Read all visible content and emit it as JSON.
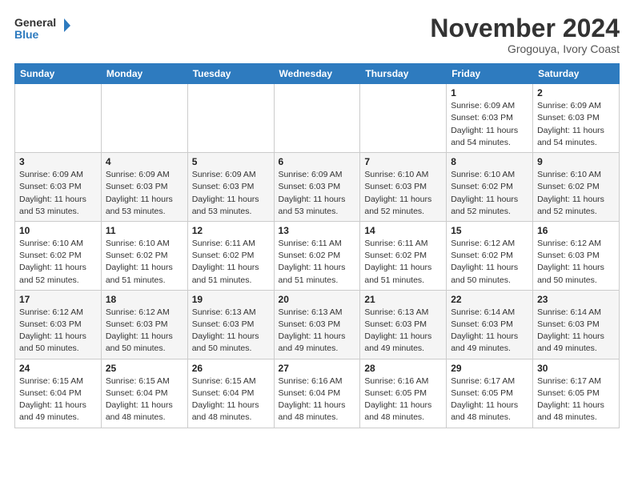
{
  "logo": {
    "line1": "General",
    "line2": "Blue"
  },
  "title": "November 2024",
  "location": "Grogouya, Ivory Coast",
  "days_header": [
    "Sunday",
    "Monday",
    "Tuesday",
    "Wednesday",
    "Thursday",
    "Friday",
    "Saturday"
  ],
  "weeks": [
    [
      {
        "day": "",
        "info": ""
      },
      {
        "day": "",
        "info": ""
      },
      {
        "day": "",
        "info": ""
      },
      {
        "day": "",
        "info": ""
      },
      {
        "day": "",
        "info": ""
      },
      {
        "day": "1",
        "info": "Sunrise: 6:09 AM\nSunset: 6:03 PM\nDaylight: 11 hours and 54 minutes."
      },
      {
        "day": "2",
        "info": "Sunrise: 6:09 AM\nSunset: 6:03 PM\nDaylight: 11 hours and 54 minutes."
      }
    ],
    [
      {
        "day": "3",
        "info": "Sunrise: 6:09 AM\nSunset: 6:03 PM\nDaylight: 11 hours and 53 minutes."
      },
      {
        "day": "4",
        "info": "Sunrise: 6:09 AM\nSunset: 6:03 PM\nDaylight: 11 hours and 53 minutes."
      },
      {
        "day": "5",
        "info": "Sunrise: 6:09 AM\nSunset: 6:03 PM\nDaylight: 11 hours and 53 minutes."
      },
      {
        "day": "6",
        "info": "Sunrise: 6:09 AM\nSunset: 6:03 PM\nDaylight: 11 hours and 53 minutes."
      },
      {
        "day": "7",
        "info": "Sunrise: 6:10 AM\nSunset: 6:03 PM\nDaylight: 11 hours and 52 minutes."
      },
      {
        "day": "8",
        "info": "Sunrise: 6:10 AM\nSunset: 6:02 PM\nDaylight: 11 hours and 52 minutes."
      },
      {
        "day": "9",
        "info": "Sunrise: 6:10 AM\nSunset: 6:02 PM\nDaylight: 11 hours and 52 minutes."
      }
    ],
    [
      {
        "day": "10",
        "info": "Sunrise: 6:10 AM\nSunset: 6:02 PM\nDaylight: 11 hours and 52 minutes."
      },
      {
        "day": "11",
        "info": "Sunrise: 6:10 AM\nSunset: 6:02 PM\nDaylight: 11 hours and 51 minutes."
      },
      {
        "day": "12",
        "info": "Sunrise: 6:11 AM\nSunset: 6:02 PM\nDaylight: 11 hours and 51 minutes."
      },
      {
        "day": "13",
        "info": "Sunrise: 6:11 AM\nSunset: 6:02 PM\nDaylight: 11 hours and 51 minutes."
      },
      {
        "day": "14",
        "info": "Sunrise: 6:11 AM\nSunset: 6:02 PM\nDaylight: 11 hours and 51 minutes."
      },
      {
        "day": "15",
        "info": "Sunrise: 6:12 AM\nSunset: 6:02 PM\nDaylight: 11 hours and 50 minutes."
      },
      {
        "day": "16",
        "info": "Sunrise: 6:12 AM\nSunset: 6:03 PM\nDaylight: 11 hours and 50 minutes."
      }
    ],
    [
      {
        "day": "17",
        "info": "Sunrise: 6:12 AM\nSunset: 6:03 PM\nDaylight: 11 hours and 50 minutes."
      },
      {
        "day": "18",
        "info": "Sunrise: 6:12 AM\nSunset: 6:03 PM\nDaylight: 11 hours and 50 minutes."
      },
      {
        "day": "19",
        "info": "Sunrise: 6:13 AM\nSunset: 6:03 PM\nDaylight: 11 hours and 50 minutes."
      },
      {
        "day": "20",
        "info": "Sunrise: 6:13 AM\nSunset: 6:03 PM\nDaylight: 11 hours and 49 minutes."
      },
      {
        "day": "21",
        "info": "Sunrise: 6:13 AM\nSunset: 6:03 PM\nDaylight: 11 hours and 49 minutes."
      },
      {
        "day": "22",
        "info": "Sunrise: 6:14 AM\nSunset: 6:03 PM\nDaylight: 11 hours and 49 minutes."
      },
      {
        "day": "23",
        "info": "Sunrise: 6:14 AM\nSunset: 6:03 PM\nDaylight: 11 hours and 49 minutes."
      }
    ],
    [
      {
        "day": "24",
        "info": "Sunrise: 6:15 AM\nSunset: 6:04 PM\nDaylight: 11 hours and 49 minutes."
      },
      {
        "day": "25",
        "info": "Sunrise: 6:15 AM\nSunset: 6:04 PM\nDaylight: 11 hours and 48 minutes."
      },
      {
        "day": "26",
        "info": "Sunrise: 6:15 AM\nSunset: 6:04 PM\nDaylight: 11 hours and 48 minutes."
      },
      {
        "day": "27",
        "info": "Sunrise: 6:16 AM\nSunset: 6:04 PM\nDaylight: 11 hours and 48 minutes."
      },
      {
        "day": "28",
        "info": "Sunrise: 6:16 AM\nSunset: 6:05 PM\nDaylight: 11 hours and 48 minutes."
      },
      {
        "day": "29",
        "info": "Sunrise: 6:17 AM\nSunset: 6:05 PM\nDaylight: 11 hours and 48 minutes."
      },
      {
        "day": "30",
        "info": "Sunrise: 6:17 AM\nSunset: 6:05 PM\nDaylight: 11 hours and 48 minutes."
      }
    ]
  ]
}
